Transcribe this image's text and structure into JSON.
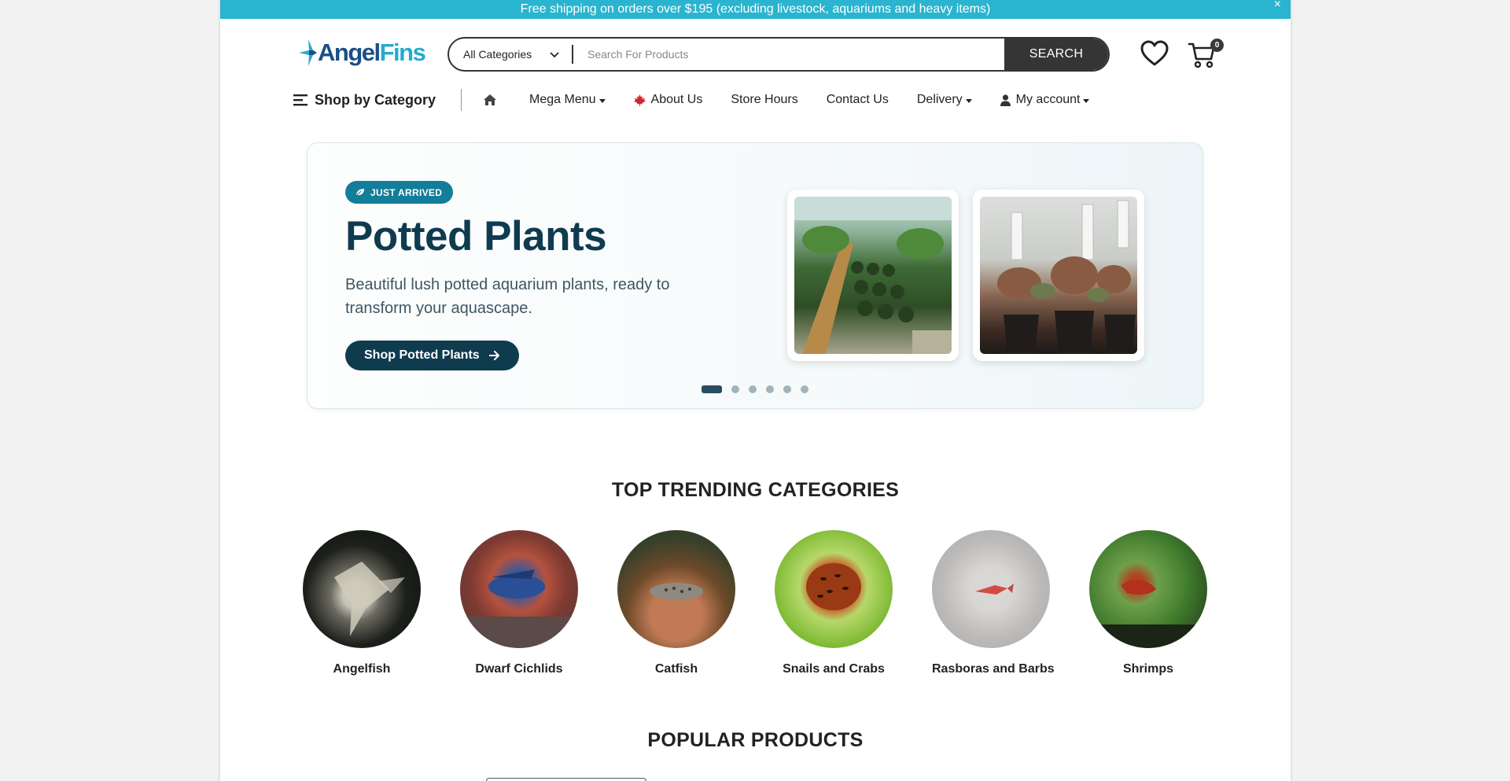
{
  "promo": {
    "text": "Free shipping on orders over $195 (excluding livestock, aquariums and heavy items)",
    "close": "×"
  },
  "brand": {
    "name_part1": "Angel",
    "name_part2": "Fins",
    "color_primary": "#1a4f86",
    "color_accent": "#25aacd"
  },
  "search": {
    "category": "All Categories",
    "placeholder": "Search For Products",
    "button": "SEARCH"
  },
  "header_icons": {
    "wishlist": "heart-icon",
    "cart": "cart-icon",
    "cart_count": "0"
  },
  "nav": {
    "shop_by_category": "Shop by Category",
    "home_icon": "home-icon",
    "mega_menu": "Mega Menu",
    "about_us": "About Us",
    "store_hours": "Store Hours",
    "contact_us": "Contact Us",
    "delivery": "Delivery",
    "my_account": "My account"
  },
  "hero": {
    "badge": "JUST ARRIVED",
    "title": "Potted Plants",
    "subtitle": "Beautiful lush potted aquarium plants, ready to transform your aquascape.",
    "cta": "Shop Potted Plants",
    "slide_count": 6,
    "active_slide": 1,
    "accent_color": "#0f3b4f"
  },
  "trending": {
    "title": "TOP TRENDING CATEGORIES",
    "categories": [
      {
        "label": "Angelfish"
      },
      {
        "label": "Dwarf Cichlids"
      },
      {
        "label": "Catfish"
      },
      {
        "label": "Snails and Crabs"
      },
      {
        "label": "Rasboras and Barbs"
      },
      {
        "label": "Shrimps"
      }
    ]
  },
  "popular": {
    "title": "POPULAR PRODUCTS"
  }
}
